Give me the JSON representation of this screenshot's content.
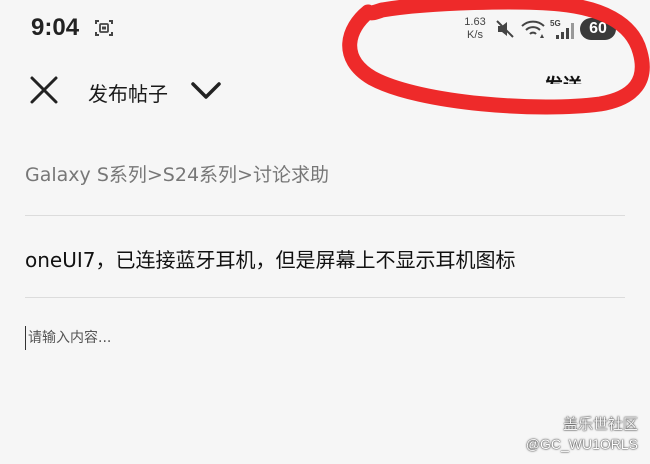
{
  "status_bar": {
    "time": "9:04",
    "network_speed_value": "1.63",
    "network_speed_unit": "K/s",
    "icons": [
      "screenshot-icon",
      "mute-icon",
      "wifi-icon",
      "signal-5g-icon"
    ],
    "battery_level": "60"
  },
  "toolbar": {
    "title": "发布帖子",
    "publish_label": "发送"
  },
  "form": {
    "category_path": "Galaxy S系列>S24系列>讨论求助",
    "post_title": "oneUI7，已连接蓝牙耳机，但是屏幕上不显示耳机图标",
    "content_placeholder": "请输入内容..."
  },
  "watermark": {
    "community": "盖乐世社区",
    "user": "@GC_WU1ORLS"
  },
  "colors": {
    "annotation": "#ee2a2a",
    "background": "#f6f6f6",
    "divider": "#dcdcdc"
  }
}
